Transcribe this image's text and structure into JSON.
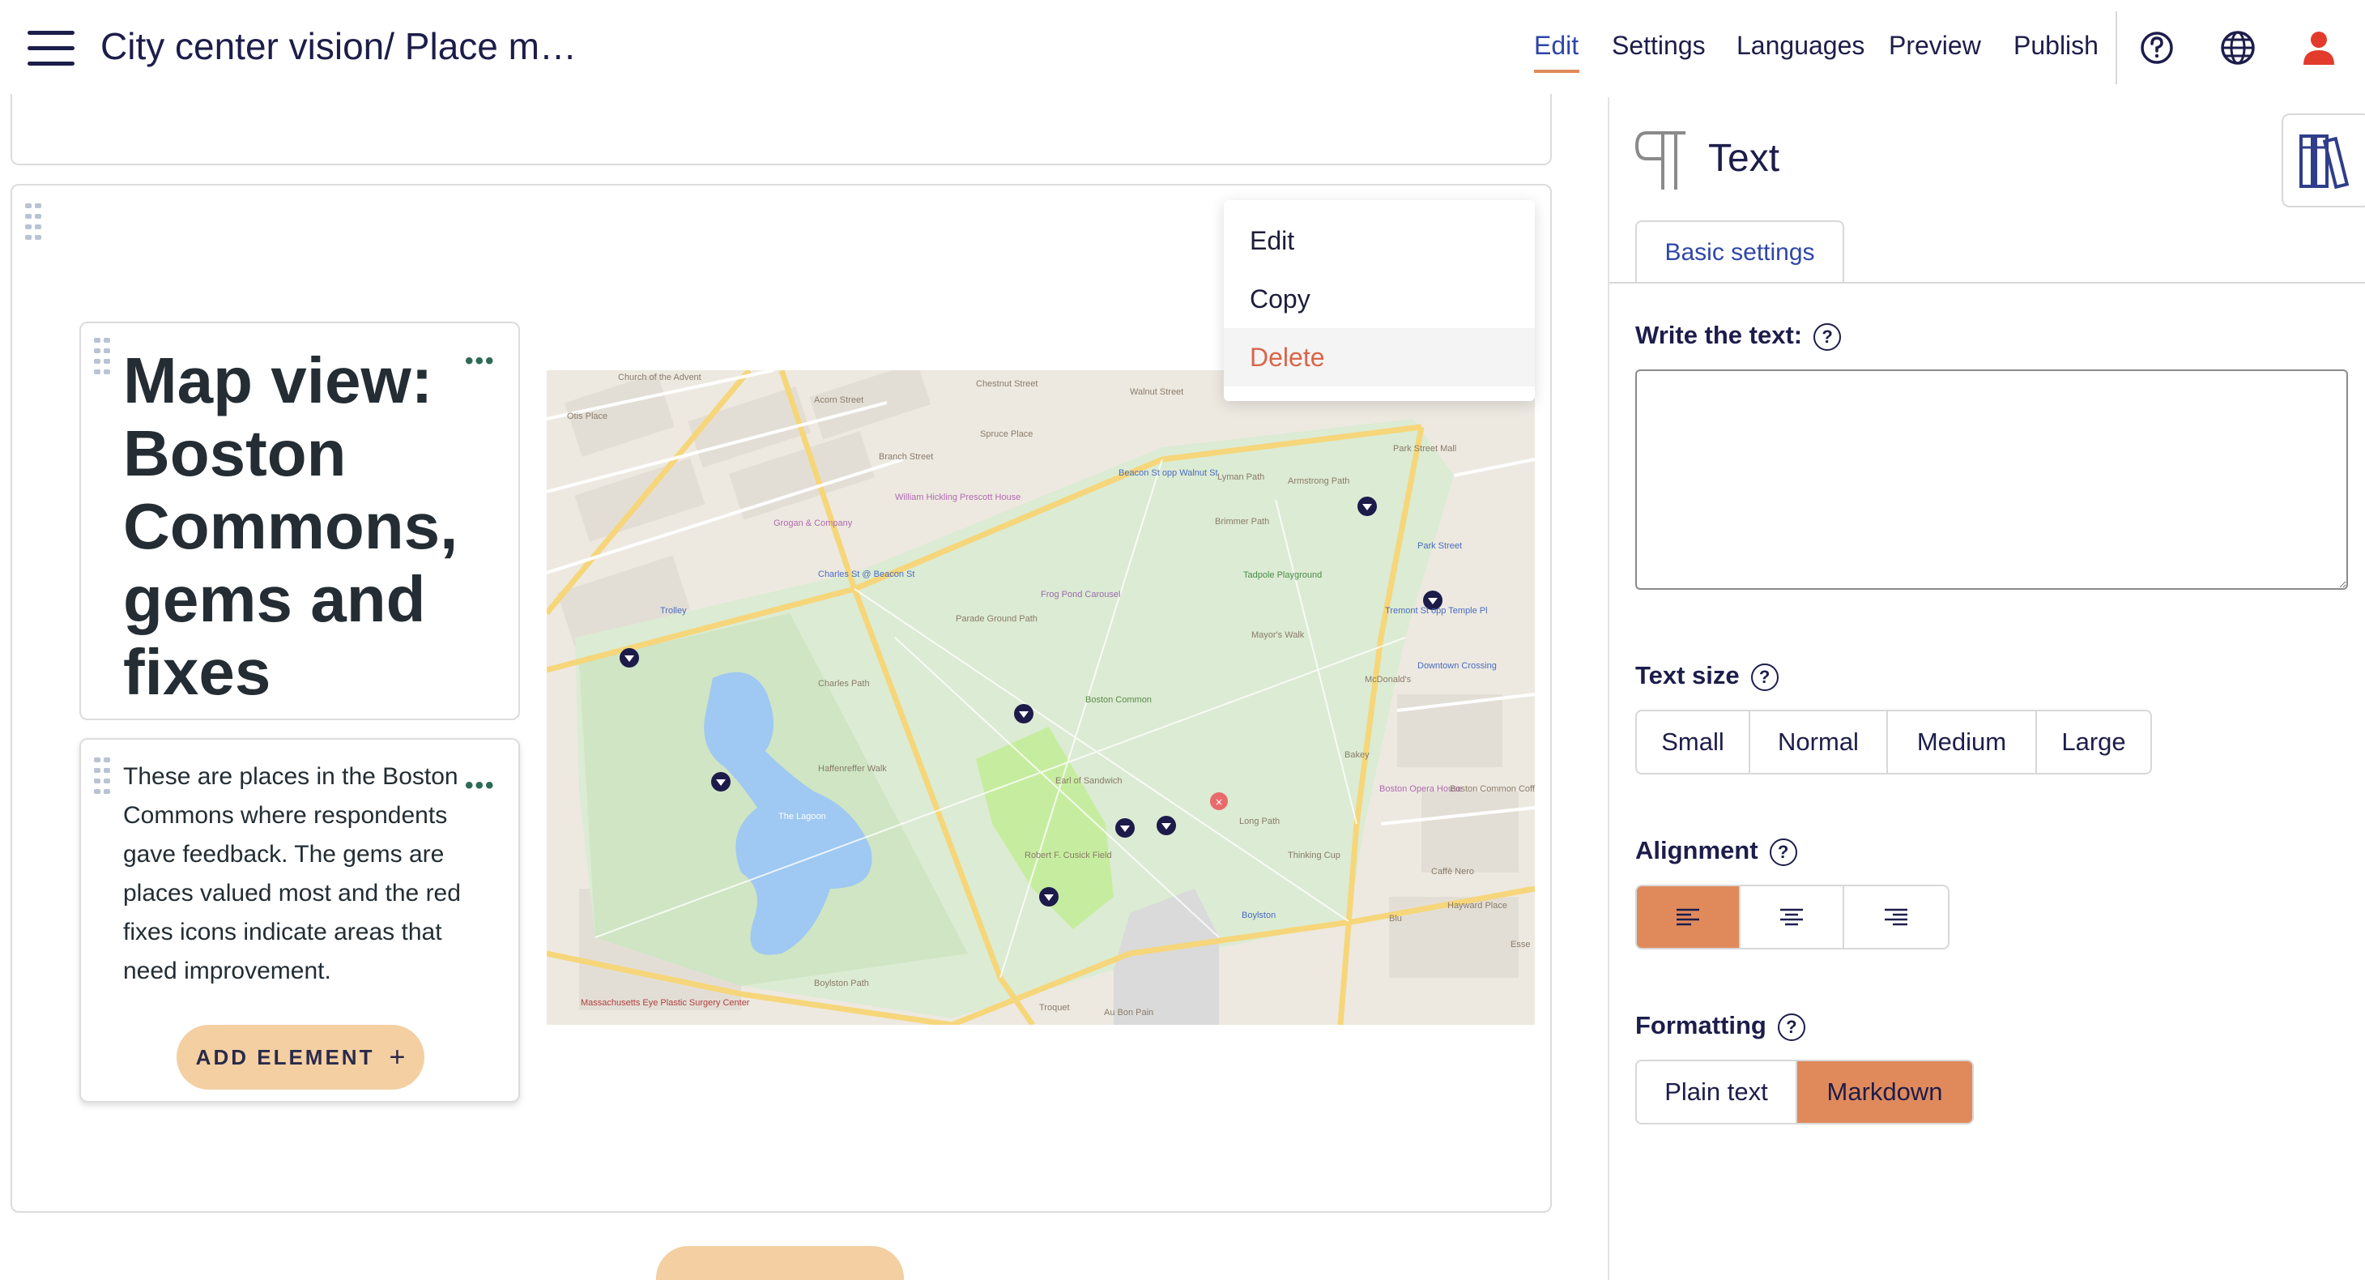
{
  "header": {
    "title": "City center vision/ Place m…",
    "nav": [
      "Edit",
      "Settings",
      "Languages",
      "Preview",
      "Publish"
    ],
    "icons": [
      "help-circle-icon",
      "globe-icon",
      "user-icon"
    ],
    "accent": "#e08a5c",
    "user_icon_color": "#e23b2c"
  },
  "canvas": {
    "heading": "Map view: Boston Commons, gems and fixes",
    "body_text": "These are places in the Boston Commons where respondents gave feedback. The gems are places valued most and the red fixes icons indicate areas that need improvement.",
    "add_element": "ADD ELEMENT",
    "more_icon": "more-dots-icon"
  },
  "context_menu": {
    "items": [
      "Edit",
      "Copy",
      "Delete"
    ]
  },
  "map": {
    "labels": [
      "Church of the Advent",
      "Acorn Street",
      "Chestnut Street",
      "Branch Street",
      "Spruce Place",
      "Walnut Street",
      "Otis Place",
      "Beacon St opp Walnut St",
      "Park Street Mall",
      "Armstrong Path",
      "Lyman Path",
      "Brimmer Path",
      "William Hickling Prescott House",
      "Grogan & Company",
      "Park Street",
      "Charles St @ Beacon St",
      "Trolley",
      "Tadpole Playground",
      "Frog Pond Carousel",
      "Mayor's Walk",
      "Tremont St opp Temple Pl",
      "Downtown Crossing",
      "Parade Ground Path",
      "McDonald's",
      "Boston Common",
      "Charles Path",
      "Haffenreffer Walk",
      "Earl of Sandwich",
      "Bakey",
      "Boston Opera House",
      "Boston Common Coffee Company",
      "The Lagoon",
      "Long Path",
      "Thinking Cup",
      "Robert F. Cusick Field",
      "Caffè Nero",
      "Boylston",
      "Hayward Place",
      "Blu",
      "Massachusetts Eye Plastic Surgery Center",
      "Boylston Path",
      "Troquet",
      "Au Bon Pain",
      "Esse"
    ]
  },
  "panel": {
    "title": "Text",
    "tab": "Basic settings",
    "write_label": "Write the text:",
    "text_value": "",
    "text_size_label": "Text size",
    "text_sizes": [
      "Small",
      "Normal",
      "Medium",
      "Large"
    ],
    "alignment_label": "Alignment",
    "alignment_selected": "left",
    "formatting_label": "Formatting",
    "formatting_options": [
      "Plain text",
      "Markdown"
    ],
    "formatting_selected": "Markdown"
  }
}
